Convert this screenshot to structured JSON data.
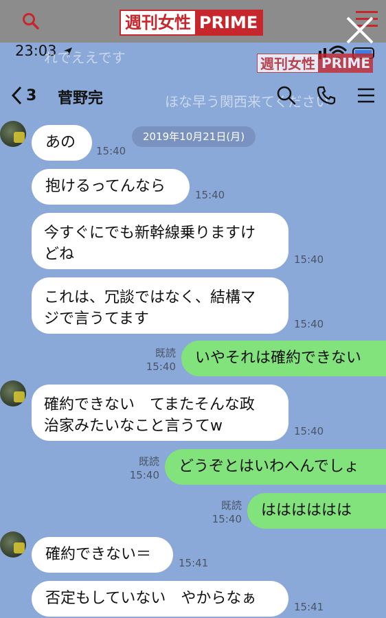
{
  "site": {
    "logo_jp": "週刊女性",
    "logo_en": "PRIME"
  },
  "status": {
    "time": "23:03"
  },
  "ghost": {
    "line1": "れでええです",
    "line2": "ほな早う関西来てください"
  },
  "header": {
    "back_count": "3",
    "name": "菅野完"
  },
  "date_divider": "2019年10月21日(月)",
  "messages": [
    {
      "dir": "in",
      "text": "あの",
      "time": "15:40"
    },
    {
      "dir": "in",
      "text": "抱けるってんなら",
      "time": "15:40"
    },
    {
      "dir": "in",
      "line1": "今すぐにでも新幹線乗りますけ",
      "line2": "どね",
      "time": "15:40"
    },
    {
      "dir": "in",
      "line1": "これは、冗談ではなく、結構マ",
      "line2": "ジで言うてます",
      "time": "15:40"
    },
    {
      "dir": "out",
      "text": "いやそれは確約できない",
      "read": "既読",
      "time": "15:40"
    },
    {
      "dir": "in",
      "line1": "確約できない　てまたそんな政",
      "line2": "治家みたいなこと言うてw",
      "time": "15:40"
    },
    {
      "dir": "out",
      "text": "どうぞとはいわへんでしょ",
      "read": "既読",
      "time": "15:40"
    },
    {
      "dir": "out",
      "text": "はははははは",
      "read": "既読",
      "time": "15:40"
    },
    {
      "dir": "in",
      "text": "確約できない＝",
      "time": "15:41"
    },
    {
      "dir": "in",
      "text": "否定もしていない　やからなぁ",
      "time": "15:41"
    }
  ],
  "colors": {
    "chat_bg": "#8aa8d8",
    "bubble_in": "#ffffff",
    "bubble_out": "#82e27c",
    "brand_red": "#c7262c"
  }
}
